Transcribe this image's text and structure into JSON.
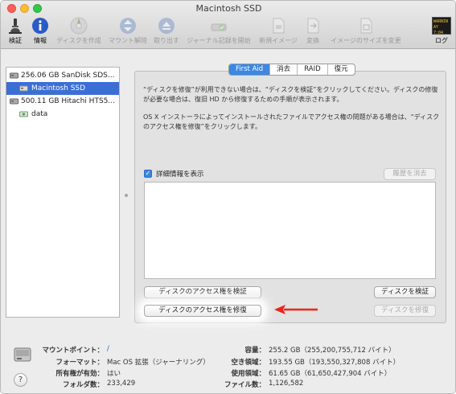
{
  "window": {
    "title": "Macintosh SSD"
  },
  "toolbar": {
    "verify": "検証",
    "info": "情報",
    "burn": "ディスクを作成",
    "unmount": "マウント解除",
    "eject": "取り出す",
    "journal": "ジャーナル記録を開始",
    "new_image": "新規イメージ",
    "convert": "変換",
    "resize_image": "イメージのサイズを変更",
    "log": "ログ",
    "log_icon_text": [
      "WARNIN",
      "AY 7:04"
    ]
  },
  "sidebar": {
    "items": [
      {
        "label": "256.06 GB SanDisk SDS...",
        "icon": "disk-icon"
      },
      {
        "label": "Macintosh SSD",
        "icon": "volume-icon"
      },
      {
        "label": "500.11 GB Hitachi HTS5...",
        "icon": "disk-icon"
      },
      {
        "label": "data",
        "icon": "volume-icon"
      }
    ]
  },
  "tabs": [
    "First Aid",
    "消去",
    "RAID",
    "復元"
  ],
  "first_aid": {
    "desc1": "“ディスクを修復”が利用できない場合は、“ディスクを検証”をクリックしてください。ディスクの修復が必要な場合は、復旧 HD から修復するための手順が表示されます。",
    "desc2": "OS X インストーラによってインストールされたファイルでアクセス権の問題がある場合は、“ディスクのアクセス権を修復”をクリックします。",
    "show_details": "詳細情報を表示",
    "clear_history": "履歴を消去",
    "verify_permissions": "ディスクのアクセス権を検証",
    "repair_permissions": "ディスクのアクセス権を修復",
    "verify_disk": "ディスクを検証",
    "repair_disk": "ディスクを修復"
  },
  "info": {
    "mount_point_label": "マウントポイント：",
    "mount_point_value": "/",
    "format_label": "フォーマット：",
    "format_value": "Mac OS 拡張（ジャーナリング）",
    "owners_label": "所有権が有効：",
    "owners_value": "はい",
    "folders_label": "フォルダ数：",
    "folders_value": "233,429",
    "capacity_label": "容量：",
    "capacity_value": "255.2 GB（255,200,755,712 バイト）",
    "available_label": "空き領域：",
    "available_value": "193.55 GB（193,550,327,808 バイト）",
    "used_label": "使用領域：",
    "used_value": "61.65 GB（61,650,427,904 バイト）",
    "files_label": "ファイル数：",
    "files_value": "1,126,582"
  },
  "colors": {
    "selection": "#3a70d6",
    "accent": "#3b87e3",
    "arrow": "#e8251e"
  }
}
